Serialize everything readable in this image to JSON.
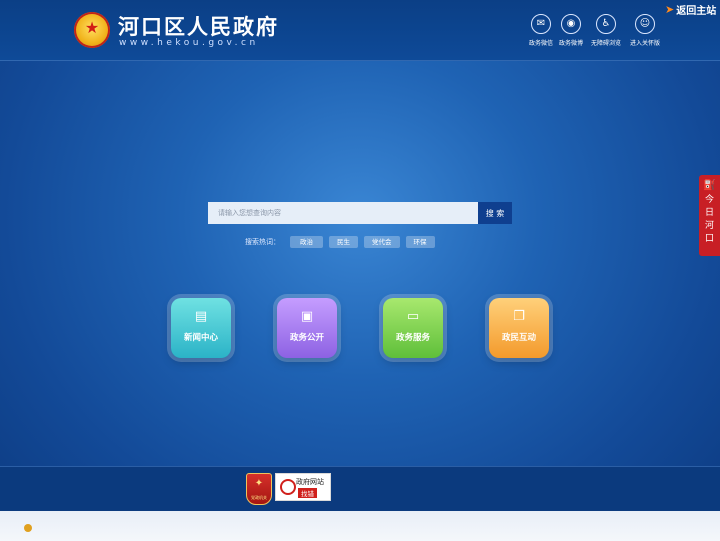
{
  "header": {
    "title": "河口区人民政府",
    "url": "www.hekou.gov.cn",
    "back_home": "返回主站",
    "tools": [
      {
        "icon": "wechat-icon",
        "glyph": "✉",
        "label": "政务微信"
      },
      {
        "icon": "weibo-icon",
        "glyph": "◉",
        "label": "政务微博"
      },
      {
        "icon": "accessibility-icon",
        "glyph": "♿",
        "label": "无障碍浏览"
      },
      {
        "icon": "elder-care-icon",
        "glyph": "☺",
        "label": "进入关怀版"
      }
    ]
  },
  "search": {
    "placeholder": "请输入您想查询内容",
    "button": "搜 索",
    "hot_label": "搜索热词：",
    "hot_words": [
      "政治",
      "民生",
      "党代会",
      "环保"
    ]
  },
  "tiles": [
    {
      "icon": "newspaper-icon",
      "glyph": "▤",
      "label": "新闻中心"
    },
    {
      "icon": "document-icon",
      "glyph": "▣",
      "label": "政务公开"
    },
    {
      "icon": "monitor-icon",
      "glyph": "▭",
      "label": "政务服务"
    },
    {
      "icon": "chat-icon",
      "glyph": "❐",
      "label": "政民互动"
    }
  ],
  "side_tab": {
    "label": "今日河口",
    "icon": "oil-pump-icon"
  },
  "footer": {
    "badge_gov_text": "党政机关",
    "badge_error_title": "政府网站",
    "badge_error_sub": "找错"
  },
  "colors": {
    "header_bg": "#0b3f86",
    "search_button": "#0f3f8f",
    "side_tab": "#c81f25",
    "tile_news": "#2bb3c7",
    "tile_open": "#8d62e3",
    "tile_service": "#5fbf3a",
    "tile_interact": "#f39a2c"
  }
}
